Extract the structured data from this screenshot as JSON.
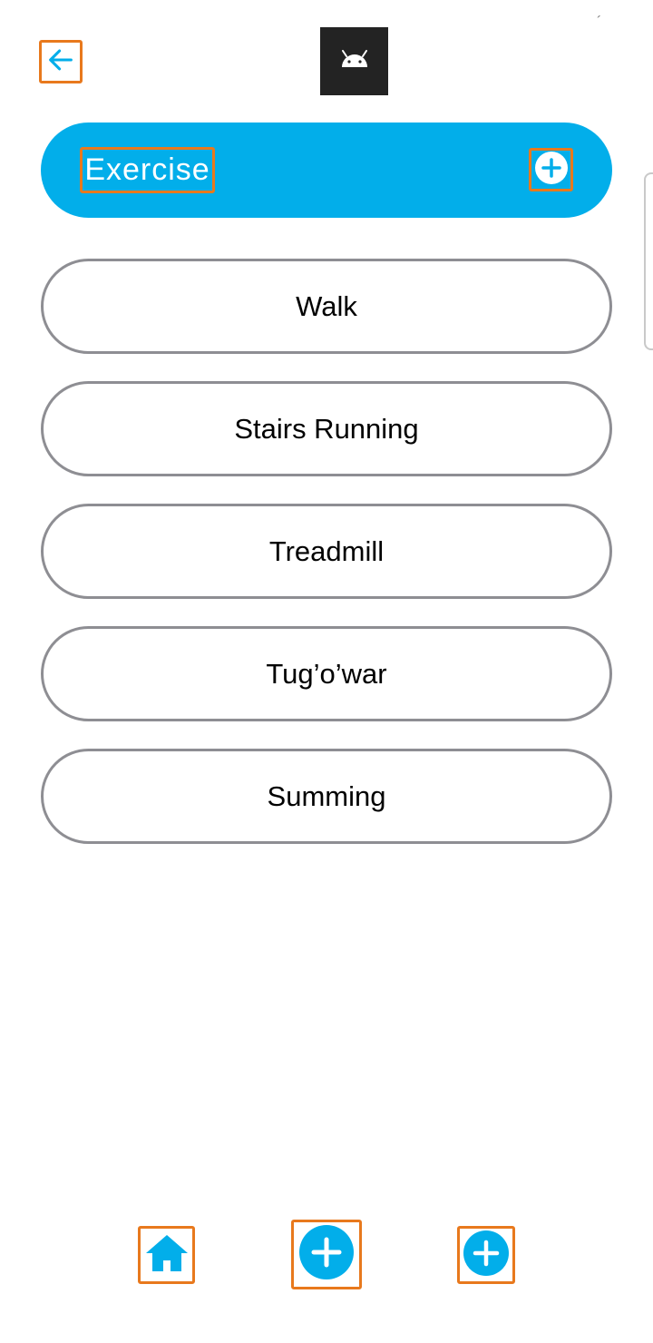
{
  "top_bar": {
    "back_icon": "arrow-left-icon",
    "logo_icon": "android-icon",
    "corner_mark": "´"
  },
  "header": {
    "title": "Exercise",
    "add_icon": "plus-circle-icon",
    "color": "#02aeea"
  },
  "exercises": [
    {
      "label": "Walk"
    },
    {
      "label": "Stairs Running"
    },
    {
      "label": "Treadmill"
    },
    {
      "label": "Tug’o’war"
    },
    {
      "label": "Summing"
    }
  ],
  "bottom_nav": {
    "items": [
      {
        "icon": "home-icon"
      },
      {
        "icon": "plus-circle-icon"
      },
      {
        "icon": "plus-circle-icon"
      }
    ]
  }
}
